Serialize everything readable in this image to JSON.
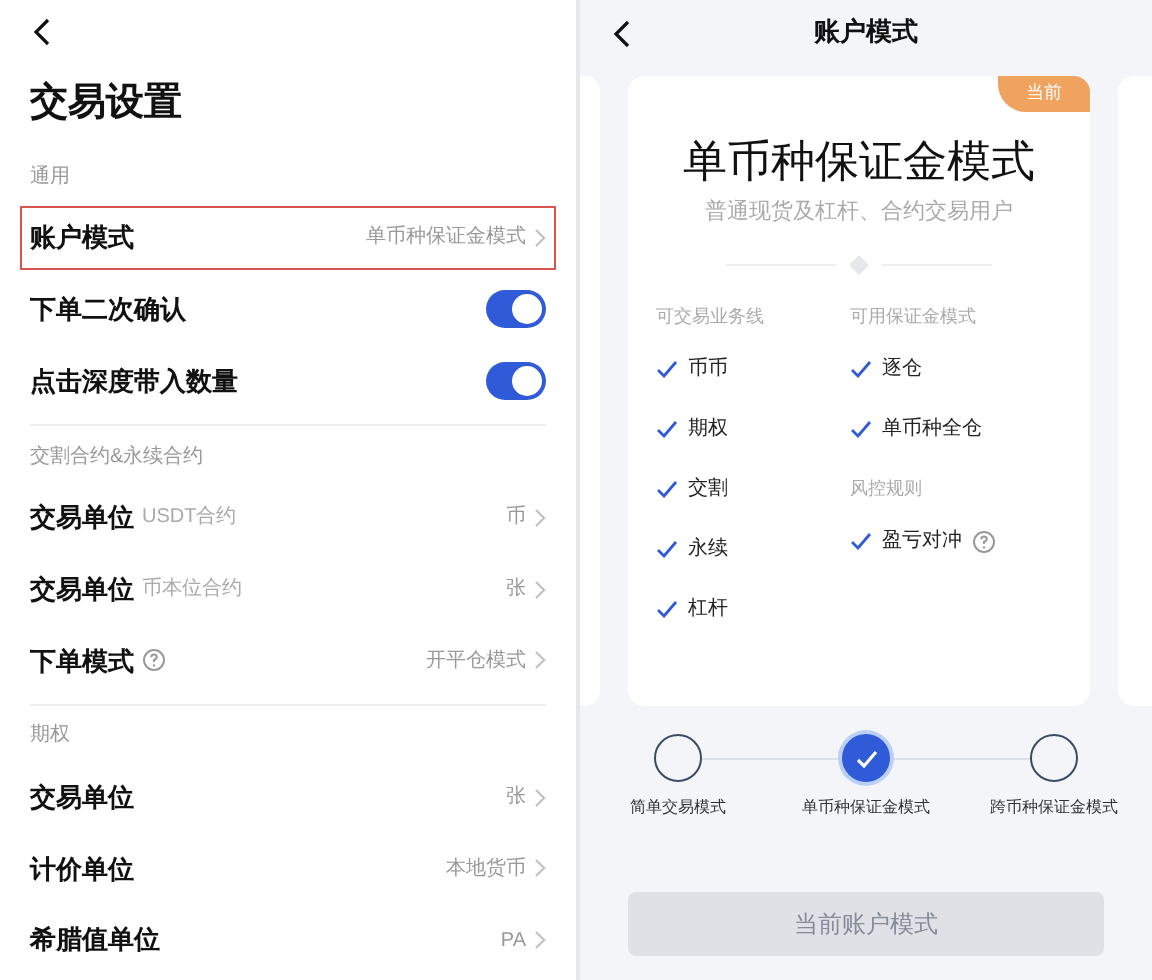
{
  "settings": {
    "title": "交易设置",
    "sections": [
      {
        "header": "通用",
        "rows": [
          {
            "kind": "value",
            "label": "账户模式",
            "value": "单币种保证金模式",
            "highlighted": true
          },
          {
            "kind": "toggle",
            "label": "下单二次确认",
            "on": true
          },
          {
            "kind": "toggle",
            "label": "点击深度带入数量",
            "on": true
          }
        ]
      },
      {
        "header": "交割合约&永续合约",
        "rows": [
          {
            "kind": "value",
            "label": "交易单位",
            "note": "USDT合约",
            "value": "币"
          },
          {
            "kind": "value",
            "label": "交易单位",
            "note": "币本位合约",
            "value": "张"
          },
          {
            "kind": "value",
            "label": "下单模式",
            "help": true,
            "value": "开平仓模式"
          }
        ]
      },
      {
        "header": "期权",
        "rows": [
          {
            "kind": "value",
            "label": "交易单位",
            "value": "张"
          },
          {
            "kind": "value",
            "label": "计价单位",
            "value": "本地货币"
          },
          {
            "kind": "value",
            "label": "希腊值单位",
            "value": "PA"
          }
        ]
      }
    ]
  },
  "account_mode": {
    "title": "账户模式",
    "card": {
      "badge": "当前",
      "title": "单币种保证金模式",
      "subtitle": "普通现货及杠杆、合约交易用户",
      "columns": [
        [
          {
            "header": "可交易业务线",
            "items": [
              {
                "label": "币币"
              },
              {
                "label": "期权"
              },
              {
                "label": "交割"
              },
              {
                "label": "永续"
              },
              {
                "label": "杠杆"
              }
            ]
          }
        ],
        [
          {
            "header": "可用保证金模式",
            "items": [
              {
                "label": "逐仓"
              },
              {
                "label": "单币种全仓"
              }
            ]
          },
          {
            "header": "风控规则",
            "items": [
              {
                "label": "盈亏对冲",
                "help": true
              }
            ]
          }
        ]
      ]
    },
    "modes": [
      {
        "label": "简单交易模式",
        "selected": false
      },
      {
        "label": "单币种保证金模式",
        "selected": true
      },
      {
        "label": "跨币种保证金模式",
        "selected": false
      }
    ],
    "button": {
      "label": "当前账户模式",
      "disabled": true
    }
  }
}
